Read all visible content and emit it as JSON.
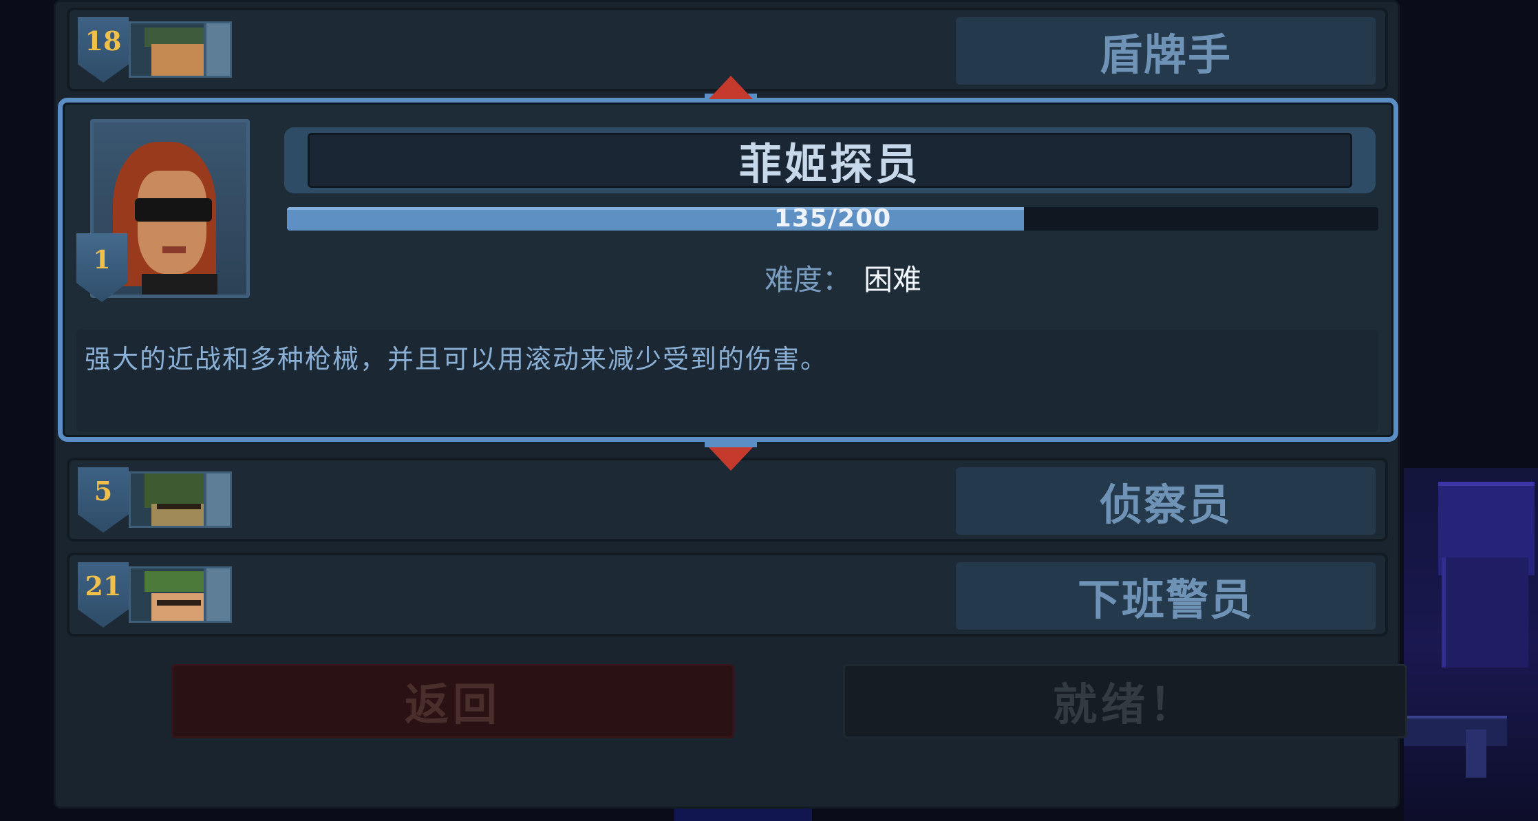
{
  "roster": [
    {
      "level": "18",
      "name": "盾牌手"
    },
    {
      "level": "5",
      "name": "侦察员"
    },
    {
      "level": "21",
      "name": "下班警员"
    }
  ],
  "selected": {
    "level": "1",
    "name": "菲姬探员",
    "xp_text": "135/200",
    "xp_fraction": 0.675,
    "difficulty_label": "难度：",
    "difficulty_value": "困难",
    "description": "强大的近战和多种枪械，并且可以用滚动来减少受到的伤害。"
  },
  "buttons": {
    "back": "返回",
    "ready": "就绪！"
  },
  "colors": {
    "accent": "#5b8ec4",
    "arrow": "#c63a2e",
    "level_number": "#f0c04a"
  }
}
